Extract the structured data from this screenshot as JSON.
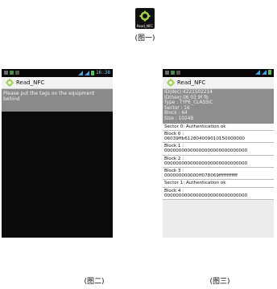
{
  "top_icon": {
    "label": "Read_NFC"
  },
  "captions": {
    "fig1": "(图一)",
    "fig2": "(图二)",
    "fig3": "(图三)"
  },
  "phone1": {
    "status_time": "16:38",
    "app_title": "Read_NFC",
    "message": "Please put the tags on the equipment behind"
  },
  "phone2": {
    "app_title": "Read_NFC",
    "info": [
      "ID(dec):4221502214",
      "ID(hex) 06 03 9f fb",
      "Type : TYPE_CLASSIC",
      "Sector : 16",
      "Block : 64",
      "Size : 1024B"
    ],
    "rows": [
      "Sector 0: Authentication ok",
      "Block 0 :",
      "06039ffb612804009010150000000",
      "Block 1 :",
      "00000000000000000000000000000",
      "Block 2 :",
      "00000000000000000000000000000",
      "Block 3 :",
      "000000000000ff078069ffffffffffff",
      "Sector 1: Authentication ok",
      "Block 4 :",
      "00000000000000000000000000000"
    ]
  },
  "colors": {
    "statusbar": "#060606",
    "android_green": "#9fd14a",
    "panel_gray": "#8a8a8a"
  }
}
